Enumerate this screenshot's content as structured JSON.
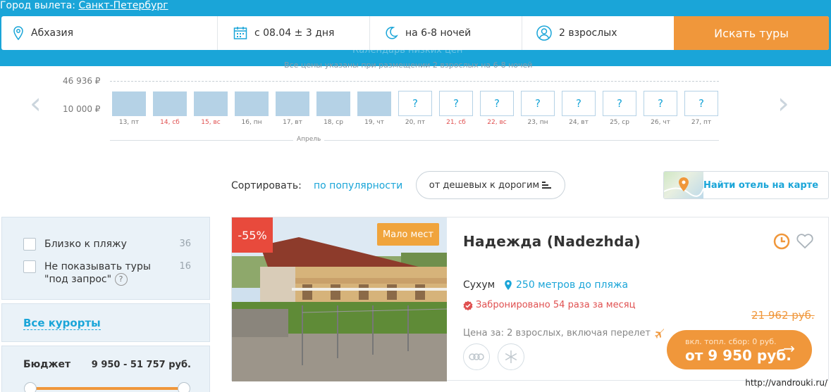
{
  "header": {
    "departure_label": "Город вылета:",
    "departure_city": "Санкт-Петербург",
    "destination": "Абхазия",
    "date": "с 08.04 ± 3 дня",
    "nights": "на 6-8 ночей",
    "people": "2 взрослых",
    "search_button": "Искать туры",
    "calendar_title": "Календарь низких цен",
    "calendar_note": "Все цены указаны при размещении 2 взрослых на 6-8 ночей"
  },
  "calendar": {
    "ymax_label": "46 936 ₽",
    "ymin_label": "10 000 ₽",
    "month": "Апрель",
    "prev_arrow": "‹",
    "next_arrow": "›",
    "days": [
      {
        "label": "13, пт",
        "weekend": false,
        "has_price": true
      },
      {
        "label": "14, сб",
        "weekend": true,
        "has_price": true
      },
      {
        "label": "15, вс",
        "weekend": true,
        "has_price": true
      },
      {
        "label": "16, пн",
        "weekend": false,
        "has_price": true
      },
      {
        "label": "17, вт",
        "weekend": false,
        "has_price": true
      },
      {
        "label": "18, ср",
        "weekend": false,
        "has_price": true
      },
      {
        "label": "19, чт",
        "weekend": false,
        "has_price": true
      },
      {
        "label": "20, пт",
        "weekend": false,
        "has_price": false
      },
      {
        "label": "21, сб",
        "weekend": true,
        "has_price": false
      },
      {
        "label": "22, вс",
        "weekend": true,
        "has_price": false
      },
      {
        "label": "23, пн",
        "weekend": false,
        "has_price": false
      },
      {
        "label": "24, вт",
        "weekend": false,
        "has_price": false
      },
      {
        "label": "25, ср",
        "weekend": false,
        "has_price": false
      },
      {
        "label": "26, чт",
        "weekend": false,
        "has_price": false
      },
      {
        "label": "27, пт",
        "weekend": false,
        "has_price": false
      }
    ],
    "unknown_mark": "?"
  },
  "sort": {
    "label": "Сортировать:",
    "popularity": "по популярности",
    "price_order": "от дешевых к дорогим",
    "map_button": "Найти отель на карте"
  },
  "filters": {
    "beach_label": "Близко к пляжу",
    "beach_count": "36",
    "no_request_line1": "Не показывать туры",
    "no_request_line2": "\"под запрос\"",
    "no_request_count": "16",
    "help_mark": "?",
    "resorts_link": "Все курорты",
    "budget_label": "Бюджет",
    "budget_range": "9 950 - 51 757 руб."
  },
  "hotel": {
    "discount": "-55%",
    "few_places": "Мало мест",
    "name": "Надежда (Nadezhda)",
    "city": "Сухум",
    "beach_distance": "250 метров до пляжа",
    "booked": "Забронировано 54 раза за месяц",
    "price_note": "Цена за: 2 взрослых, включая перелет",
    "old_price": "21 962 руб.",
    "fee_note": "вкл. топл. сбор: 0 руб.",
    "price": "от 9 950 руб.",
    "price_arrow": "→"
  },
  "footer": {
    "url": "http://vandrouki.ru/"
  },
  "colors": {
    "brand_blue": "#1aa5d8",
    "accent_orange": "#f0973b",
    "discount_red": "#e84a3c"
  }
}
